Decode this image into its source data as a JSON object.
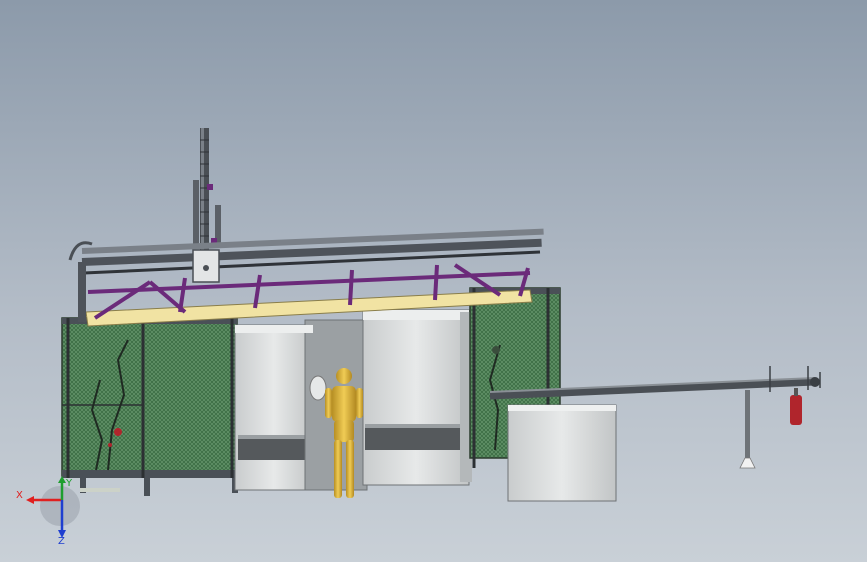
{
  "viewport": {
    "colors": {
      "background_top": "#8c9aaa",
      "background_bottom": "#c9d0d7",
      "frame_steel": "#5a6068",
      "gantry_purple": "#6b2a7a",
      "beam_yellow": "#f1e3a3",
      "guard_mesh": "#3f6f48",
      "machine_body": "#d9dbdb",
      "operator_figure": "#d9b23c",
      "motor_red": "#b0252c"
    }
  },
  "triad": {
    "x_label": "X",
    "y_label": "Y",
    "z_label": "Z",
    "colors": {
      "x": "#e02020",
      "y": "#1e9e2e",
      "z": "#1f3fd0"
    }
  }
}
